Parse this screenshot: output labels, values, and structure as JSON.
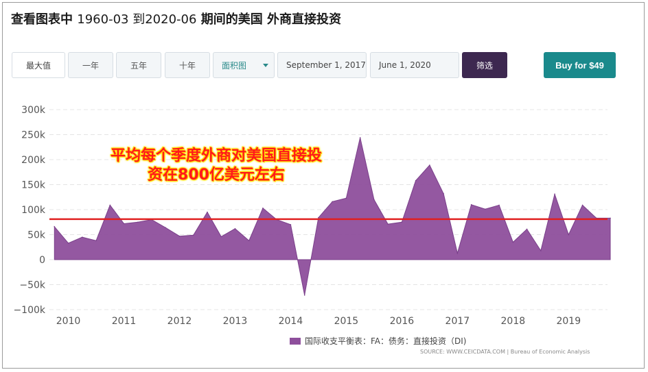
{
  "header": {
    "title_pre": "查看图表中",
    "title_dates": "1960-03 到2020-06",
    "title_post": "期间的美国 外商直接投资"
  },
  "toolbar": {
    "range_buttons": [
      "最大值",
      "一年",
      "五年",
      "十年"
    ],
    "chart_type_select": "面积图",
    "start_date": "September 1, 2017",
    "end_date": "June 1, 2020",
    "filter_label": "筛选",
    "buy_label": "Buy for $49"
  },
  "annotation": {
    "line1": "平均每个季度外商对美国直接投",
    "line2": "资在800亿美元左右"
  },
  "legend": {
    "label": "国际收支平衡表：FA：债务：直接投资（DI)"
  },
  "source": {
    "text": "SOURCE: WWW.CEICDATA.COM | Bureau of Economic Analysis"
  },
  "colors": {
    "area_fill": "#8e4f9c",
    "area_stroke": "#7a3f8a",
    "average_line": "#e02020",
    "filter_button": "#3d2850",
    "buy_button": "#1a8a8c"
  },
  "chart_data": {
    "type": "area",
    "series": [
      {
        "name": "国际收支平衡表：FA：债务：直接投资（DI)",
        "x": [
          2009.75,
          2010.0,
          2010.25,
          2010.5,
          2010.75,
          2011.0,
          2011.25,
          2011.5,
          2011.75,
          2012.0,
          2012.25,
          2012.5,
          2012.75,
          2013.0,
          2013.25,
          2013.5,
          2013.75,
          2014.0,
          2014.25,
          2014.5,
          2014.75,
          2015.0,
          2015.25,
          2015.5,
          2015.75,
          2016.0,
          2016.25,
          2016.5,
          2016.75,
          2017.0,
          2017.25,
          2017.5,
          2017.75,
          2018.0,
          2018.25,
          2018.5,
          2018.75,
          2019.0,
          2019.25,
          2019.5,
          2019.75
        ],
        "values": [
          66,
          33,
          45,
          38,
          109,
          72,
          75,
          80,
          64,
          47,
          49,
          95,
          46,
          62,
          38,
          103,
          80,
          70,
          -71,
          84,
          116,
          123,
          244,
          120,
          71,
          75,
          158,
          189,
          132,
          13,
          110,
          101,
          109,
          35,
          61,
          18,
          131,
          50,
          109,
          83,
          83
        ]
      }
    ],
    "average_line": 81,
    "ylim": [
      -100,
      300
    ],
    "yticks": [
      -100,
      -50,
      0,
      50,
      100,
      150,
      200,
      250,
      300
    ],
    "ytick_labels": [
      "−100k",
      "−50k",
      "0",
      "50k",
      "100k",
      "150k",
      "200k",
      "250k",
      "300k"
    ],
    "xlim": [
      2009.66,
      2019.7
    ],
    "xticks": [
      2010,
      2011,
      2012,
      2013,
      2014,
      2015,
      2016,
      2017,
      2018,
      2019
    ],
    "xtick_labels": [
      "2010",
      "2011",
      "2012",
      "2013",
      "2014",
      "2015",
      "2016",
      "2017",
      "2018",
      "2019"
    ],
    "grid": true,
    "legend_position": "bottom-center"
  }
}
